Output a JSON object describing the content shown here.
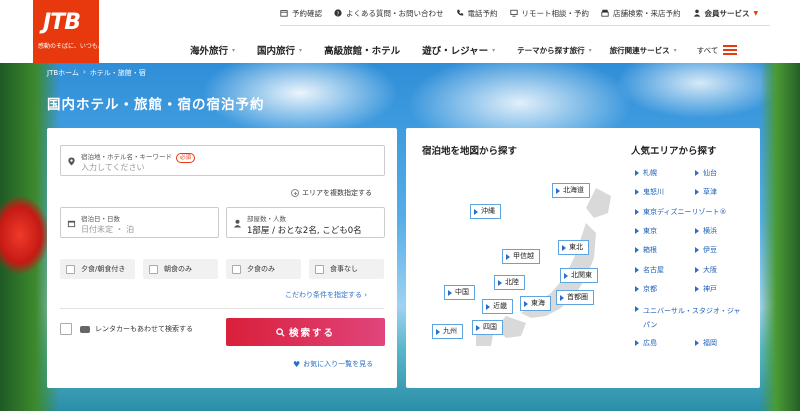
{
  "header": {
    "logo_text": "JTB",
    "logo_tagline": "感動のそばに、いつも。",
    "utility": [
      {
        "label": "予約確認",
        "icon": "calendar-icon"
      },
      {
        "label": "よくある質問・お問い合わせ",
        "icon": "question-icon"
      },
      {
        "label": "電話予約",
        "icon": "phone-icon"
      },
      {
        "label": "リモート相談・予約",
        "icon": "monitor-icon"
      },
      {
        "label": "店舗検索・来店予約",
        "icon": "store-icon"
      },
      {
        "label": "会員サービス",
        "icon": "user-icon"
      }
    ],
    "nav": [
      "海外旅行",
      "国内旅行",
      "高級旅館・ホテル",
      "遊び・レジャー",
      "テーマから探す旅行",
      "旅行関連サービス"
    ],
    "all_label": "すべて"
  },
  "breadcrumb": [
    "JTBホーム",
    "›",
    "ホテル・旅館・宿"
  ],
  "page_title": "国内ホテル・旅館・宿の宿泊予約",
  "search": {
    "keyword_label": "宿泊地・ホテル名・キーワード",
    "required_badge": "必須",
    "keyword_placeholder": "入力してください",
    "multi_area": "エリアを複数指定する",
    "date_label": "宿泊日・日数",
    "date_value": "日付未定 ・ 泊",
    "room_label": "部屋数・人数",
    "room_value": "1部屋 / おとな2名, こども0名",
    "meals": [
      "夕食/朝食付き",
      "朝食のみ",
      "夕食のみ",
      "食事なし"
    ],
    "conditions_link": "こだわり条件を指定する ›",
    "rentacar_label": "レンタカーもあわせて検索する",
    "search_button": "検索する",
    "favorites_link": "お気に入り一覧を見る"
  },
  "map": {
    "title": "宿泊地を地図から探す",
    "regions": [
      "北海道",
      "沖縄",
      "東北",
      "甲信越",
      "北関東",
      "中国",
      "北陸",
      "首都圏",
      "近畿",
      "東海",
      "九州",
      "四国"
    ]
  },
  "popular": {
    "title": "人気エリアから探す",
    "items": [
      "札幌",
      "仙台",
      "鬼怒川",
      "草津",
      "東京ディズニーリゾート®",
      "東京",
      "横浜",
      "箱根",
      "伊豆",
      "名古屋",
      "大阪",
      "京都",
      "神戸",
      "ユニバーサル・スタジオ・ジャパン",
      "広島",
      "福岡"
    ]
  },
  "colors": {
    "brand": "#e8380d",
    "link": "#1d5fb8",
    "search_button": "#e0306a"
  }
}
